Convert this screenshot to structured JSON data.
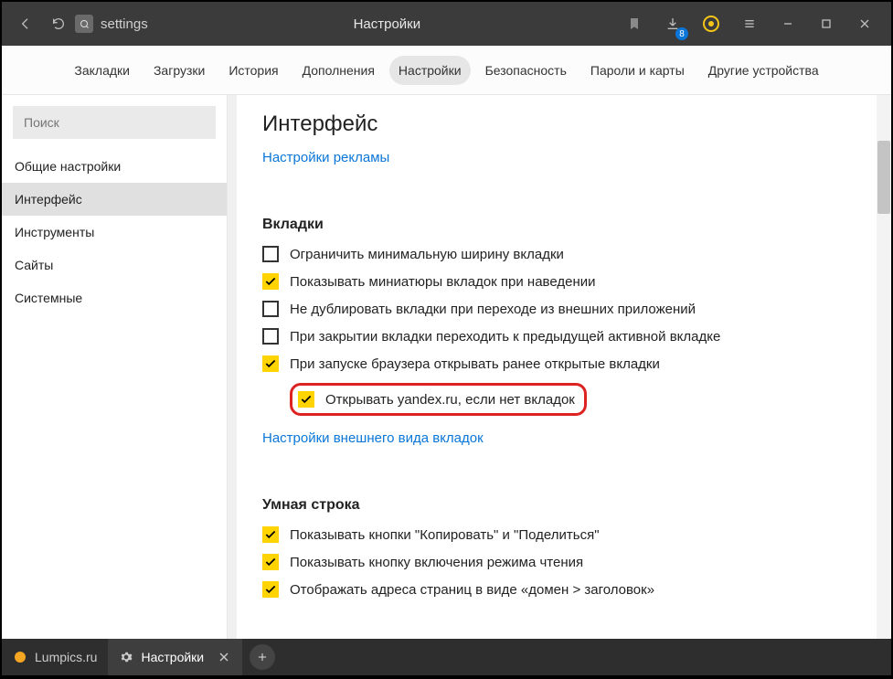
{
  "titlebar": {
    "address": "settings",
    "tab_title": "Настройки",
    "download_count": "8"
  },
  "topnav": {
    "items": [
      "Закладки",
      "Загрузки",
      "История",
      "Дополнения",
      "Настройки",
      "Безопасность",
      "Пароли и карты",
      "Другие устройства"
    ],
    "active_index": 4
  },
  "sidebar": {
    "search_placeholder": "Поиск",
    "items": [
      "Общие настройки",
      "Интерфейс",
      "Инструменты",
      "Сайты",
      "Системные"
    ],
    "selected_index": 1
  },
  "main": {
    "heading": "Интерфейс",
    "ad_link": "Настройки рекламы",
    "tabs_section": {
      "title": "Вкладки",
      "options": [
        {
          "label": "Ограничить минимальную ширину вкладки",
          "checked": false,
          "indent": false
        },
        {
          "label": "Показывать миниатюры вкладок при наведении",
          "checked": true,
          "indent": false
        },
        {
          "label": "Не дублировать вкладки при переходе из внешних приложений",
          "checked": false,
          "indent": false
        },
        {
          "label": "При закрытии вкладки переходить к предыдущей активной вкладке",
          "checked": false,
          "indent": false
        },
        {
          "label": "При запуске браузера открывать ранее открытые вкладки",
          "checked": true,
          "indent": false
        },
        {
          "label": "Открывать yandex.ru, если нет вкладок",
          "checked": true,
          "indent": true,
          "highlight": true
        }
      ],
      "appearance_link": "Настройки внешнего вида вкладок"
    },
    "smart_section": {
      "title": "Умная строка",
      "options": [
        {
          "label": "Показывать кнопки \"Копировать\" и \"Поделиться\"",
          "checked": true
        },
        {
          "label": "Показывать кнопку включения режима чтения",
          "checked": true
        },
        {
          "label": "Отображать адреса страниц в виде «домен > заголовок»",
          "checked": true
        }
      ]
    }
  },
  "tabstrip": {
    "tabs": [
      {
        "label": "Lumpics.ru",
        "icon": "orange",
        "active": false
      },
      {
        "label": "Настройки",
        "icon": "gear",
        "active": true
      }
    ]
  }
}
